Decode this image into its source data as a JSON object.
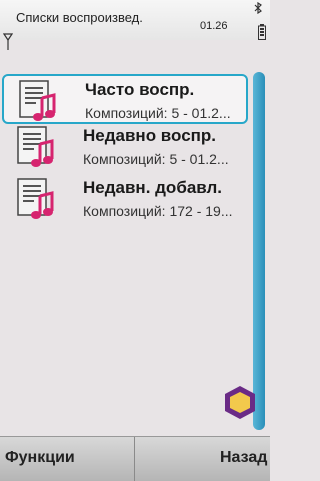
{
  "status": {
    "title": "Списки воспроизвед.",
    "time": "01.26"
  },
  "list": {
    "items": [
      {
        "title": "Часто воспр.",
        "subtitle": "Композиций: 5 - 01.2...",
        "selected": true
      },
      {
        "title": "Недавно воспр.",
        "subtitle": "Композиций: 5 - 01.2...",
        "selected": false
      },
      {
        "title": "Недавн. добавл.",
        "subtitle": "Композиций: 172 - 19...",
        "selected": false
      }
    ]
  },
  "softkeys": {
    "left": "Функции",
    "right": "Назад"
  },
  "colors": {
    "accent": "#27a7c9",
    "note": "#d6246f"
  }
}
